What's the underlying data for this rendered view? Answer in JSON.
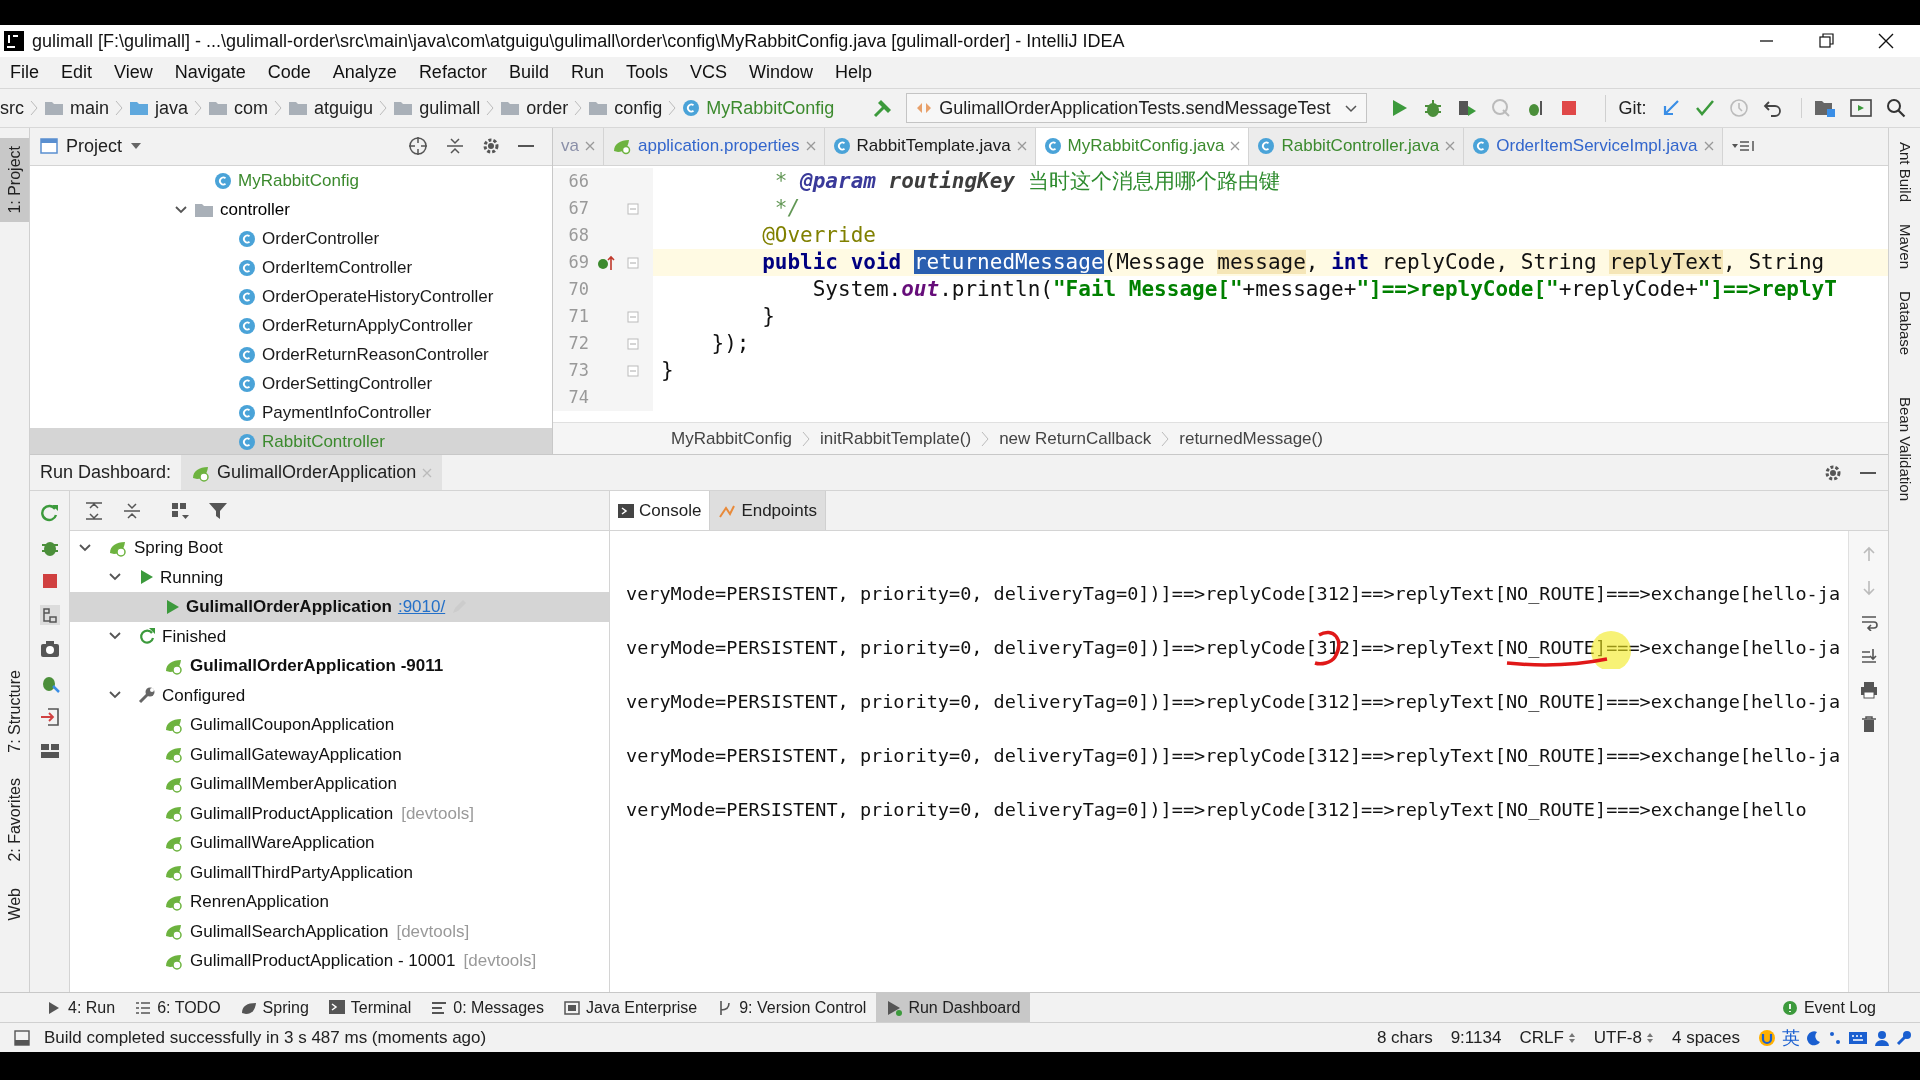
{
  "window": {
    "title": "gulimall [F:\\gulimall] - ...\\gulimall-order\\src\\main\\java\\com\\atguigu\\gulimall\\order\\config\\MyRabbitConfig.java [gulimall-order] - IntelliJ IDEA"
  },
  "menu": [
    "File",
    "Edit",
    "View",
    "Navigate",
    "Code",
    "Analyze",
    "Refactor",
    "Build",
    "Run",
    "Tools",
    "VCS",
    "Window",
    "Help"
  ],
  "nav_breadcrumb": [
    {
      "label": "src",
      "kind": "plain"
    },
    {
      "label": "main",
      "kind": "folder"
    },
    {
      "label": "java",
      "kind": "source-folder"
    },
    {
      "label": "com",
      "kind": "folder"
    },
    {
      "label": "atguigu",
      "kind": "folder"
    },
    {
      "label": "gulimall",
      "kind": "folder"
    },
    {
      "label": "order",
      "kind": "folder"
    },
    {
      "label": "config",
      "kind": "folder"
    },
    {
      "label": "MyRabbitConfig",
      "kind": "class"
    }
  ],
  "toolbar": {
    "run_config": "GulimallOrderApplicationTests.sendMessageTest",
    "git_label": "Git:"
  },
  "left_tool_windows": [
    {
      "label": "1: Project",
      "selected": true
    },
    {
      "label": "7: Structure",
      "selected": false
    },
    {
      "label": "2: Favorites",
      "selected": false
    },
    {
      "label": "Web",
      "selected": false
    }
  ],
  "right_tool_windows": [
    "Ant Build",
    "Maven",
    "Database",
    "Bean Validation"
  ],
  "project_panel": {
    "title": "Project",
    "tree": [
      {
        "label": "MyRabbitConfig",
        "kind": "class",
        "color": "#3c8a2e",
        "selected": false
      },
      {
        "label": "controller",
        "kind": "folder",
        "expanded": true,
        "selected": false,
        "children": [
          {
            "label": "OrderController",
            "kind": "class",
            "color": "#1a1a1a",
            "selected": false
          },
          {
            "label": "OrderItemController",
            "kind": "class",
            "color": "#1a1a1a",
            "selected": false
          },
          {
            "label": "OrderOperateHistoryController",
            "kind": "class",
            "color": "#1a1a1a",
            "selected": false
          },
          {
            "label": "OrderReturnApplyController",
            "kind": "class",
            "color": "#1a1a1a",
            "selected": false
          },
          {
            "label": "OrderReturnReasonController",
            "kind": "class",
            "color": "#1a1a1a",
            "selected": false
          },
          {
            "label": "OrderSettingController",
            "kind": "class",
            "color": "#1a1a1a",
            "selected": false
          },
          {
            "label": "PaymentInfoController",
            "kind": "class",
            "color": "#1a1a1a",
            "selected": false
          },
          {
            "label": "RabbitController",
            "kind": "class",
            "color": "#3c8a2e",
            "selected": true
          }
        ]
      }
    ]
  },
  "editor": {
    "tabs": [
      {
        "label": "va",
        "kind": "java",
        "color": "#8a8fa8",
        "selected": false
      },
      {
        "label": "application.properties",
        "kind": "properties",
        "color": "#3366cc",
        "selected": false
      },
      {
        "label": "RabbitTemplate.java",
        "kind": "class",
        "color": "#1a1a1a",
        "selected": false
      },
      {
        "label": "MyRabbitConfig.java",
        "kind": "class",
        "color": "#3c8a2e",
        "selected": true
      },
      {
        "label": "RabbitController.java",
        "kind": "class",
        "color": "#3c8a2e",
        "selected": false
      },
      {
        "label": "OrderItemServiceImpl.java",
        "kind": "class",
        "color": "#3366cc",
        "selected": false
      }
    ],
    "lines": [
      {
        "number": "66",
        "current": false,
        "marker": false,
        "fold": false,
        "segments": [
          {
            "kind": "comment",
            "text": "         * "
          },
          {
            "kind": "doc-tag",
            "text": "@param"
          },
          {
            "kind": "doc-param",
            "text": " routingKey"
          },
          {
            "kind": "doc-text",
            "text": " 当时这个消息用哪个路由键"
          }
        ]
      },
      {
        "number": "67",
        "current": false,
        "marker": false,
        "fold": true,
        "segments": [
          {
            "kind": "comment",
            "text": "         */"
          }
        ]
      },
      {
        "number": "68",
        "current": false,
        "marker": false,
        "fold": false,
        "segments": [
          {
            "kind": "annotation",
            "text": "        @Override"
          }
        ]
      },
      {
        "number": "69",
        "current": true,
        "marker": true,
        "fold": true,
        "segments": [
          {
            "kind": "keyword",
            "text": "        public void "
          },
          {
            "kind": "selected",
            "text": "returnedMessage"
          },
          {
            "kind": "plain",
            "text": "(Message "
          },
          {
            "kind": "usage",
            "text": "message"
          },
          {
            "kind": "plain",
            "text": ", "
          },
          {
            "kind": "keyword",
            "text": "int"
          },
          {
            "kind": "plain",
            "text": " replyCode, String "
          },
          {
            "kind": "usage",
            "text": "replyText"
          },
          {
            "kind": "plain",
            "text": ", String"
          }
        ]
      },
      {
        "number": "70",
        "current": false,
        "marker": false,
        "fold": false,
        "segments": [
          {
            "kind": "plain",
            "text": "            System."
          },
          {
            "kind": "static-field",
            "text": "out"
          },
          {
            "kind": "plain",
            "text": ".println("
          },
          {
            "kind": "string",
            "text": "\"Fail Message[\""
          },
          {
            "kind": "plain",
            "text": "+message+"
          },
          {
            "kind": "string",
            "text": "\"]==>replyCode[\""
          },
          {
            "kind": "plain",
            "text": "+replyCode+"
          },
          {
            "kind": "string",
            "text": "\"]==>replyT"
          }
        ]
      },
      {
        "number": "71",
        "current": false,
        "marker": false,
        "fold": true,
        "segments": [
          {
            "kind": "plain",
            "text": "        }"
          }
        ]
      },
      {
        "number": "72",
        "current": false,
        "marker": false,
        "fold": true,
        "segments": [
          {
            "kind": "plain",
            "text": "    });"
          }
        ]
      },
      {
        "number": "73",
        "current": false,
        "marker": false,
        "fold": true,
        "segments": [
          {
            "kind": "plain",
            "text": "}"
          }
        ]
      },
      {
        "number": "74",
        "current": false,
        "marker": false,
        "fold": false
      }
    ],
    "breadcrumb": [
      "MyRabbitConfig",
      "initRabbitTemplate()",
      "new ReturnCallback",
      "returnedMessage()"
    ]
  },
  "run_dashboard": {
    "title": "Run Dashboard:",
    "tabs": [
      {
        "label": "GulimallOrderApplication",
        "selected": true
      }
    ],
    "tree": [
      {
        "label": "Spring Boot",
        "kind": "spring-boot",
        "expanded": true,
        "children": [
          {
            "label": "Running",
            "kind": "running",
            "expanded": true,
            "children": [
              {
                "label": "GulimallOrderApplication",
                "kind": "running-app",
                "selected": true,
                "link": ":9010/"
              }
            ]
          },
          {
            "label": "Finished",
            "kind": "finished",
            "expanded": true,
            "children": [
              {
                "label": "GulimallOrderApplication -9011",
                "kind": "finished-app",
                "selected": false
              }
            ]
          },
          {
            "label": "Configured",
            "kind": "configured",
            "expanded": true,
            "children": [
              {
                "label": "GulimallCouponApplication",
                "kind": "app",
                "selected": false
              },
              {
                "label": "GulimallGatewayApplication",
                "kind": "app",
                "selected": false
              },
              {
                "label": "GulimallMemberApplication",
                "kind": "app",
                "selected": false
              },
              {
                "label": "GulimallProductApplication",
                "kind": "app",
                "selected": false,
                "tag": "[devtools]"
              },
              {
                "label": "GulimallWareApplication",
                "kind": "app",
                "selected": false
              },
              {
                "label": "GulimallThirdPartyApplication",
                "kind": "app",
                "selected": false
              },
              {
                "label": "RenrenApplication",
                "kind": "app",
                "selected": false
              },
              {
                "label": "GulimallSearchApplication",
                "kind": "app",
                "selected": false,
                "tag": "[devtools]"
              },
              {
                "label": "GulimallProductApplication - 10001",
                "kind": "app",
                "selected": false,
                "tag": "[devtools]"
              }
            ]
          }
        ]
      }
    ],
    "console_tabs": [
      {
        "label": "Console",
        "kind": "console",
        "selected": true
      },
      {
        "label": "Endpoints",
        "kind": "endpoints",
        "selected": false
      }
    ],
    "console_lines": [
      {
        "text": "veryMode=PERSISTENT, priority=0, deliveryTag=0])]==>replyCode[312]==>replyText[NO_ROUTE]===>exchange[hello-ja",
        "marked": false
      },
      {
        "text": "veryMode=PERSISTENT, priority=0, deliveryTag=0])]==>replyCode[312]==>replyText[NO_ROUTE]===>exchange[hello-ja",
        "marked": true
      },
      {
        "text": "veryMode=PERSISTENT, priority=0, deliveryTag=0])]==>replyCode[312]==>replyText[NO_ROUTE]===>exchange[hello-ja",
        "marked": false
      },
      {
        "text": "veryMode=PERSISTENT, priority=0, deliveryTag=0])]==>replyCode[312]==>replyText[NO_ROUTE]===>exchange[hello-ja",
        "marked": false
      },
      {
        "text": "veryMode=PERSISTENT, priority=0, deliveryTag=0])]==>replyCode[312]==>replyText[NO_ROUTE]===>exchange[hello",
        "marked": false
      }
    ]
  },
  "bottom_tools": [
    {
      "label": "4: Run",
      "kind": "run",
      "selected": false
    },
    {
      "label": "6: TODO",
      "kind": "todo",
      "selected": false
    },
    {
      "label": "Spring",
      "kind": "spring",
      "selected": false
    },
    {
      "label": "Terminal",
      "kind": "terminal",
      "selected": false
    },
    {
      "label": "0: Messages",
      "kind": "messages",
      "selected": false
    },
    {
      "label": "Java Enterprise",
      "kind": "enterprise",
      "selected": false
    },
    {
      "label": "9: Version Control",
      "kind": "vcs",
      "selected": false
    },
    {
      "label": "Run Dashboard",
      "kind": "dashboard",
      "selected": true
    }
  ],
  "event_log": "Event Log",
  "status_bar": {
    "message": "Build completed successfully in 3 s 487 ms (moments ago)",
    "items": [
      "8 chars",
      "9:1134",
      "CRLF",
      "UTF-8",
      "4 spaces"
    ],
    "ime": "英"
  }
}
